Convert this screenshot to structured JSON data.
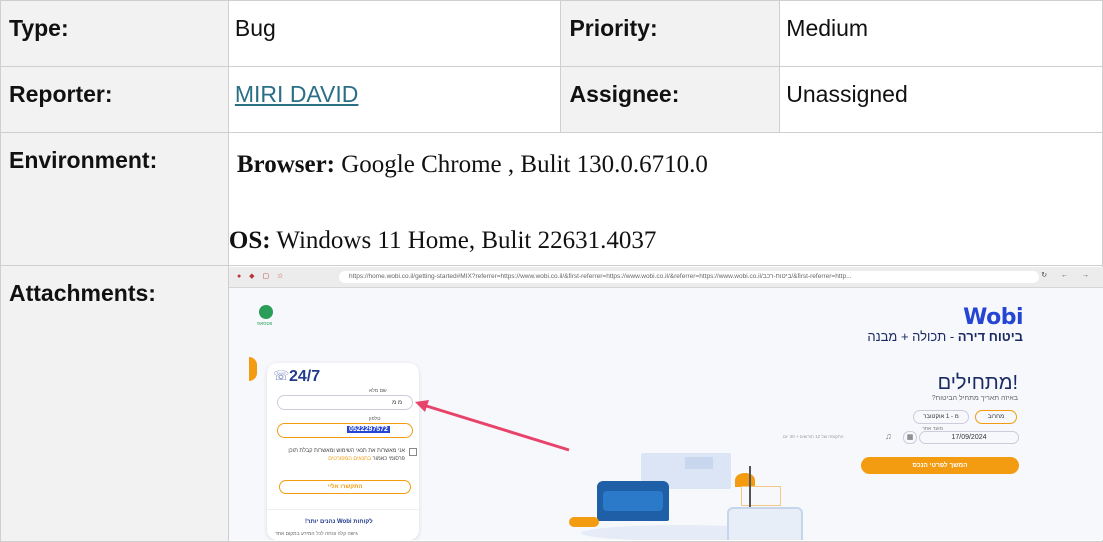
{
  "fields": {
    "type": {
      "label": "Type:",
      "value": "Bug"
    },
    "priority": {
      "label": "Priority:",
      "value": "Medium"
    },
    "reporter": {
      "label": "Reporter:",
      "value": "MIRI DAVID"
    },
    "assignee": {
      "label": "Assignee:",
      "value": "Unassigned"
    },
    "environment": {
      "label": "Environment:",
      "browser_key": "Browser:",
      "browser_value": " Google Chrome , Bulit 130.0.6710.0",
      "os_key": "OS:",
      "os_value": " Windows 11 Home, Bulit 22631.4037"
    },
    "attachments": {
      "label": "Attachments:"
    }
  },
  "attachment_screenshot": {
    "url": "https://home.wobi.co.il/getting-started#MIX?referrer=https://www.wobi.co.il/&first-referrer=https://www.wobi.co.il/&referrer=https://www.wobi.co.il/ביטוח-רכב/&first-referrer=http...",
    "logo": "Wobi",
    "subtitle_bold": "ביטוח דירה",
    "subtitle_rest": " - תכולה + מבנה",
    "support": "24/7",
    "name_label": "שם מלא",
    "name_value": "מ מ",
    "phone_label": "טלפון",
    "phone_value": "0522297572",
    "consent_text": "אני מאשר/ת את תנאי השימוש ומאשר/ת קבלת תוכן פרסומי כאמור ",
    "consent_link": "בתנאים המפורטים",
    "call_button": "התקשרו אליי",
    "app_promo": "לקוחות Wobi נהנים יותר!",
    "app_small": "גישה קלה ונוחה לכל המידע במקום אחד",
    "heading": "מתחילים!",
    "question": "באיזה תאריך מתחיל הביטוח?",
    "pill_tomorrow": "מחרוב",
    "pill_other": "מ - 1 אוקטובר",
    "date_label": "מועד אחר",
    "date_value": "17/09/2024",
    "hint": "התקופה של 12 חודשים + 30 יום",
    "continue_button": "המשך לפרטי הנכס",
    "whatsapp": "ווטסאפ"
  },
  "colors": {
    "link": "#2a6f86",
    "label_bg": "#f2f2f2",
    "wobi_blue": "#2546d4",
    "accent_orange": "#f39c12",
    "arrow": "#e8436b"
  }
}
